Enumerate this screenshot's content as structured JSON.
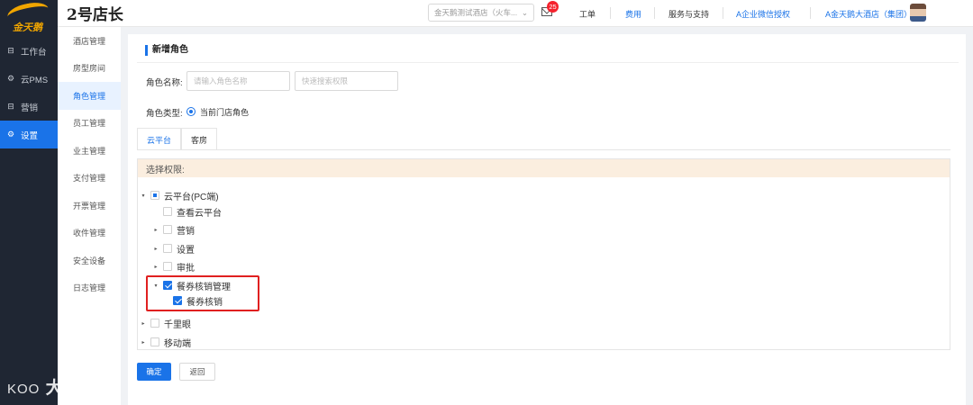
{
  "logo": {
    "text": "金天鹅"
  },
  "sidebar": {
    "items": [
      {
        "label": "工作台",
        "icon": "⊟"
      },
      {
        "label": "云PMS",
        "icon": "⚙"
      },
      {
        "label": "营销",
        "icon": "⊟"
      },
      {
        "label": "设置",
        "icon": "⚙"
      }
    ]
  },
  "header": {
    "title": "2号店长",
    "hotel_select": "金天鹅测试酒店（火车...",
    "mail_badge": "25",
    "links": {
      "workorder": "工单",
      "fee": "费用",
      "support": "服务与支持",
      "wechat": "A企业微信授权",
      "group": "A金天鹅大酒店（集团）"
    }
  },
  "subnav": {
    "items": [
      "酒店管理",
      "房型房间",
      "角色管理",
      "员工管理",
      "业主管理",
      "支付管理",
      "开票管理",
      "收件管理",
      "安全设备",
      "日志管理"
    ]
  },
  "form": {
    "panel_title": "新增角色",
    "role_name_label": "角色名称:",
    "role_name_placeholder": "请输入角色名称",
    "search_placeholder": "快速搜索权限",
    "role_type_label": "角色类型:",
    "role_type_value": "当前门店角色"
  },
  "tabs": [
    "云平台",
    "客房"
  ],
  "permissions": {
    "header": "选择权限:",
    "tree": [
      {
        "label": "云平台(PC端)",
        "caret": "▾",
        "state": "partial"
      },
      {
        "label": "查看云平台",
        "caret": "",
        "state": "unchecked"
      },
      {
        "label": "营销",
        "caret": "▸",
        "state": "unchecked"
      },
      {
        "label": "设置",
        "caret": "▸",
        "state": "unchecked"
      },
      {
        "label": "审批",
        "caret": "▸",
        "state": "unchecked"
      },
      {
        "label": "餐券核销管理",
        "caret": "▾",
        "state": "checked"
      },
      {
        "label": "餐券核销",
        "caret": "",
        "state": "checked"
      },
      {
        "label": "千里眼",
        "caret": "▸",
        "state": "unchecked"
      },
      {
        "label": "移动端",
        "caret": "▸",
        "state": "unchecked"
      }
    ]
  },
  "buttons": {
    "confirm": "确定",
    "back": "返回"
  },
  "watermark": {
    "text": "大数跨境",
    "icon_text": "KOO"
  }
}
